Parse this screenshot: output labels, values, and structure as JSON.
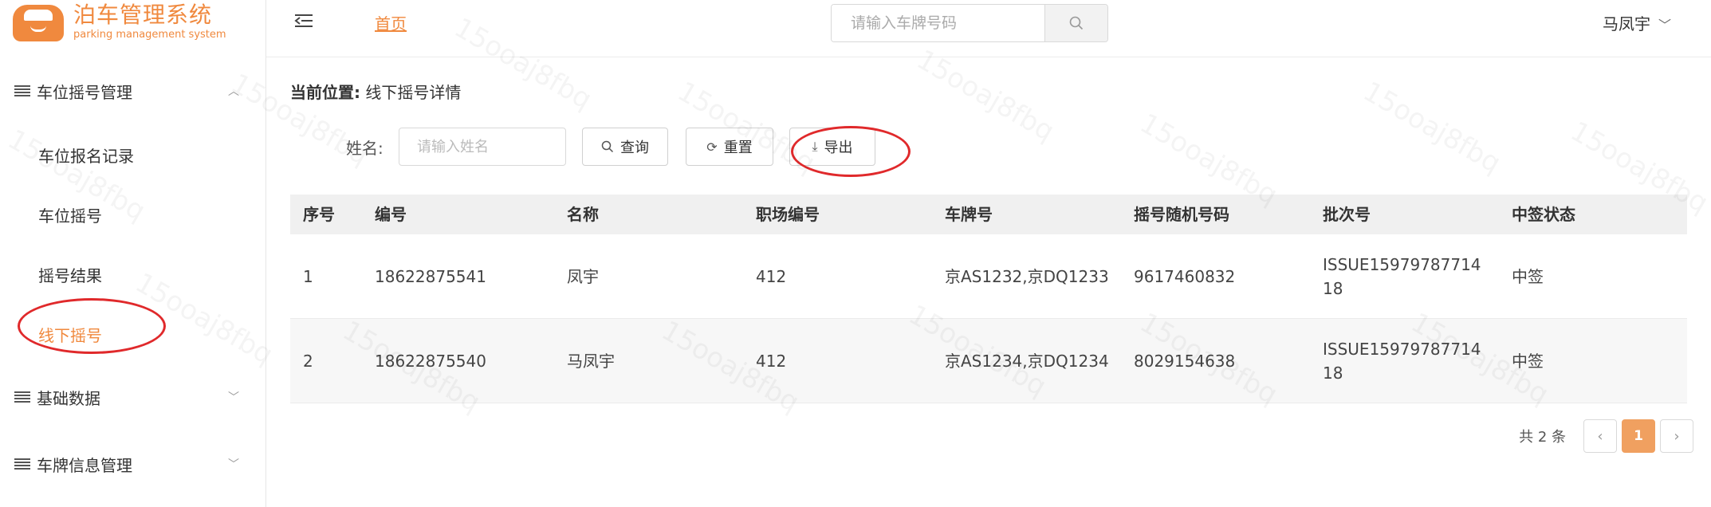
{
  "app": {
    "title": "泊车管理系统",
    "subtitle": "parking management system",
    "brand_color": "#f0893e"
  },
  "sidebar": {
    "groups": [
      {
        "label": "车位摇号管理",
        "expanded": true,
        "icon": "menu-lines-icon"
      },
      {
        "label": "基础数据",
        "expanded": false,
        "icon": "menu-lines-icon"
      },
      {
        "label": "车牌信息管理",
        "expanded": false,
        "icon": "menu-lines-icon"
      }
    ],
    "items": [
      {
        "label": "车位报名记录"
      },
      {
        "label": "车位摇号"
      },
      {
        "label": "摇号结果"
      },
      {
        "label": "线下摇号",
        "active": true
      }
    ]
  },
  "header": {
    "home_link": "首页",
    "search_placeholder": "请输入车牌号码",
    "user_name": "马凤宇"
  },
  "main": {
    "location_label": "当前位置:",
    "location_value": "线下摇号详情",
    "filter": {
      "name_label": "姓名:",
      "name_placeholder": "请输入姓名"
    },
    "buttons": {
      "query": "查询",
      "reset": "重置",
      "export": "导出"
    },
    "table": {
      "headers": [
        "序号",
        "编号",
        "名称",
        "职场编号",
        "车牌号",
        "摇号随机号码",
        "批次号",
        "中签状态"
      ],
      "rows": [
        [
          "1",
          "18622875541",
          "凤宇",
          "412",
          "京AS1232,京DQ1233",
          "9617460832",
          "ISSUE1597978771418",
          "中签"
        ],
        [
          "2",
          "18622875540",
          "马凤宇",
          "412",
          "京AS1234,京DQ1234",
          "8029154638",
          "ISSUE1597978771418",
          "中签"
        ]
      ]
    },
    "pagination": {
      "total_text": "共 2 条",
      "current_page": "1"
    }
  },
  "watermark": "15ooaj8fbq"
}
